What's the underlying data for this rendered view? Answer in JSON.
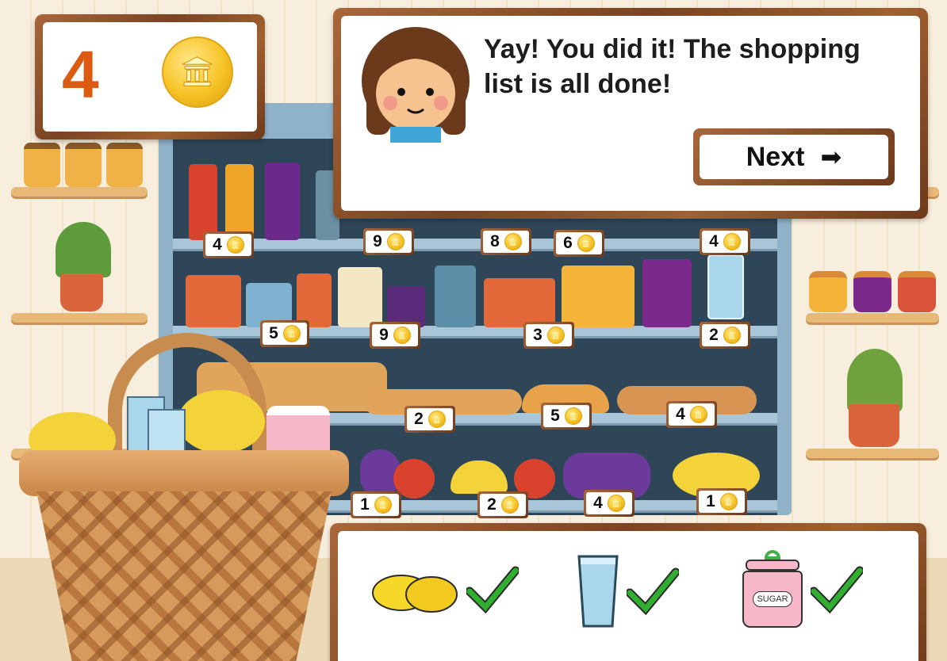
{
  "coin_counter": {
    "count": "4",
    "icon": "coin-icon"
  },
  "dialog": {
    "message": "Yay! You did it! The shopping list is all done!",
    "next_label": "Next",
    "next_icon": "arrow-right-icon"
  },
  "price_tags": [
    {
      "id": "ketchup",
      "price": "4"
    },
    {
      "id": "shelf1-item2",
      "price": "9"
    },
    {
      "id": "shelf1-item3",
      "price": "8"
    },
    {
      "id": "shelf1-item4",
      "price": "6"
    },
    {
      "id": "shelf1-item5",
      "price": "4"
    },
    {
      "id": "can",
      "price": "5"
    },
    {
      "id": "milk",
      "price": "9"
    },
    {
      "id": "box",
      "price": "3"
    },
    {
      "id": "glass",
      "price": "2"
    },
    {
      "id": "bread",
      "price": "2"
    },
    {
      "id": "croissant",
      "price": "5"
    },
    {
      "id": "loaf",
      "price": "4"
    },
    {
      "id": "grapes-apple",
      "price": "1"
    },
    {
      "id": "banana",
      "price": "2"
    },
    {
      "id": "grapes",
      "price": "4"
    },
    {
      "id": "lemons",
      "price": "1"
    }
  ],
  "shopping_list": {
    "items": [
      {
        "name": "lemons",
        "done": true
      },
      {
        "name": "glass",
        "done": true
      },
      {
        "name": "sugar",
        "done": true,
        "label": "SUGAR"
      }
    ]
  },
  "colors": {
    "wood": "#7a4422",
    "count": "#dd5a12",
    "check": "#2fae2f"
  }
}
